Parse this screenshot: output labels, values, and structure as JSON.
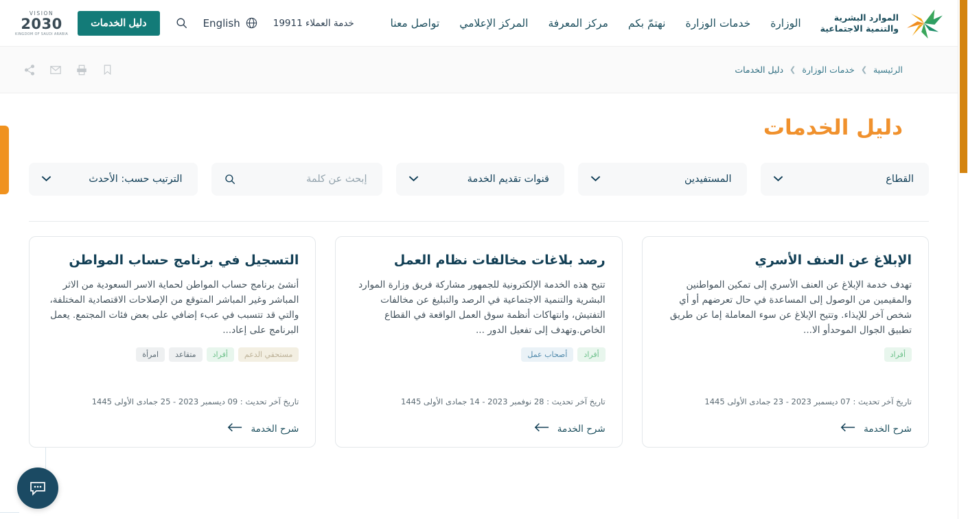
{
  "header": {
    "brand": {
      "line1": "الموارد البشرية",
      "line2": "والتنمية الاجتماعية",
      "logo_icon": "hrsd-star-logo"
    },
    "nav": [
      {
        "label": "الوزارة",
        "name": "nav-ministry"
      },
      {
        "label": "خدمات الوزارة",
        "name": "nav-ministry-services"
      },
      {
        "label": "نهتمّ بكم",
        "name": "nav-we-care"
      },
      {
        "label": "مركز المعرفة",
        "name": "nav-knowledge-center"
      },
      {
        "label": "المركز الإعلامي",
        "name": "nav-media-center"
      },
      {
        "label": "تواصل معنا",
        "name": "nav-contact-us"
      }
    ],
    "support_text": "خدمة العملاء 19911",
    "language_label": "English",
    "language_icon": "globe-icon",
    "search_icon": "search-icon",
    "services_button": "دليل الخدمات",
    "vision": {
      "top": "VISION",
      "mid": "2030",
      "bottom": "KINGDOM OF SAUDI ARABIA"
    }
  },
  "breadcrumb": {
    "items": [
      {
        "label": "الرئيسية",
        "name": "breadcrumb-home"
      },
      {
        "label": "خدمات الوزارة",
        "name": "breadcrumb-ministry-services"
      },
      {
        "label": "دليل الخدمات",
        "name": "breadcrumb-services-guide"
      }
    ],
    "separator": "❮"
  },
  "tools": [
    {
      "name": "share-icon",
      "title": "مشاركة"
    },
    {
      "name": "email-icon",
      "title": "بريد"
    },
    {
      "name": "print-icon",
      "title": "طباعة"
    },
    {
      "name": "bookmark-icon",
      "title": "حفظ"
    }
  ],
  "hero": {
    "title": "دليل الخدمات"
  },
  "filters": {
    "sector": {
      "label": "القطاع",
      "name": "filter-sector"
    },
    "beneficiaries": {
      "label": "المستفيدين",
      "name": "filter-beneficiaries"
    },
    "channels": {
      "label": "قنوات تقديم الخدمة",
      "name": "filter-channels"
    },
    "sort": {
      "label": "الترتيب حسب: الأحدث",
      "name": "filter-sort"
    },
    "search_placeholder": "إبحث عن كلمة",
    "search_value": ""
  },
  "cards": [
    {
      "title": "الإبلاغ عن العنف الأسري",
      "description": "تهدف خدمة الإبلاغ عن العنف الأسري إلى تمكين المواطنين والمقيمين من الوصول إلى المساعدة في حال تعرضهم أو أي شخص آخر للإيذاء. وتتيح الإبلاغ عن سوء المعاملة إما عن طريق تطبيق الجوال الموحدأو الا...",
      "tags": [
        {
          "label": "أفراد",
          "style": "green"
        }
      ],
      "date": "تاريخ آخر تحديث : 07 ديسمبر 2023 - 23 جمادى الأولى 1445",
      "more_label": "شرح الخدمة"
    },
    {
      "title": "رصد بلاغات مخالفات نظام العمل",
      "description": "تتيح هذه الخدمة الإلكترونية للجمهور مشاركة فريق وزارة الموارد البشرية والتنمية الاجتماعية في الرصد والتبليغ عن مخالفات التفتيش، وانتهاكات أنظمة سوق العمل الواقعة في القطاع الخاص.وتهدف إلى تفعيل الدور ...",
      "tags": [
        {
          "label": "أفراد",
          "style": "green"
        },
        {
          "label": "أصحاب عمل",
          "style": "blue"
        }
      ],
      "date": "تاريخ آخر تحديث : 28 نوفمبر 2023 - 14 جمادى الأولى 1445",
      "more_label": "شرح الخدمة"
    },
    {
      "title": "التسجيل في برنامج حساب المواطن",
      "description": "أنشئ برنامج حساب المواطن لحماية الاسر السعودية من الاثر المباشر وغير المباشر المتوقع من الإصلاحات الاقتصادية المختلفة، والتي قد تتسبب في عبء إضافي على بعض فئات المجتمع. يعمل البرنامج على إعاد...",
      "tags": [
        {
          "label": "مستحقي الدعم",
          "style": "beige"
        },
        {
          "label": "أفراد",
          "style": "green"
        },
        {
          "label": "متقاعد",
          "style": "gray"
        },
        {
          "label": "امرأة",
          "style": "gray"
        }
      ],
      "date": "تاريخ آخر تحديث : 09 ديسمبر 2023 - 25 جمادى الأولى 1445",
      "more_label": "شرح الخدمة"
    }
  ],
  "chat": {
    "icon": "chat-bubble-icon",
    "label": "محادثة"
  },
  "colors": {
    "teal_button": "#137b78",
    "hero_orange": "#f0912d",
    "side_tab_orange": "#f0921f",
    "scrollbar_orange": "#d4840f",
    "navy": "#123f55",
    "chat_navy": "#1b4a63"
  }
}
